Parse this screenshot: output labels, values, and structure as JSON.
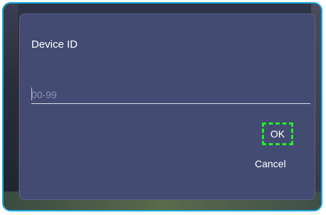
{
  "dialog": {
    "title": "Device ID",
    "input": {
      "value": "",
      "placeholder": "00-99"
    },
    "ok_label": "OK",
    "cancel_label": "Cancel"
  },
  "colors": {
    "dialog_bg": "#434b73",
    "frame_border": "#1aa8e0",
    "highlight": "#22ee22"
  }
}
